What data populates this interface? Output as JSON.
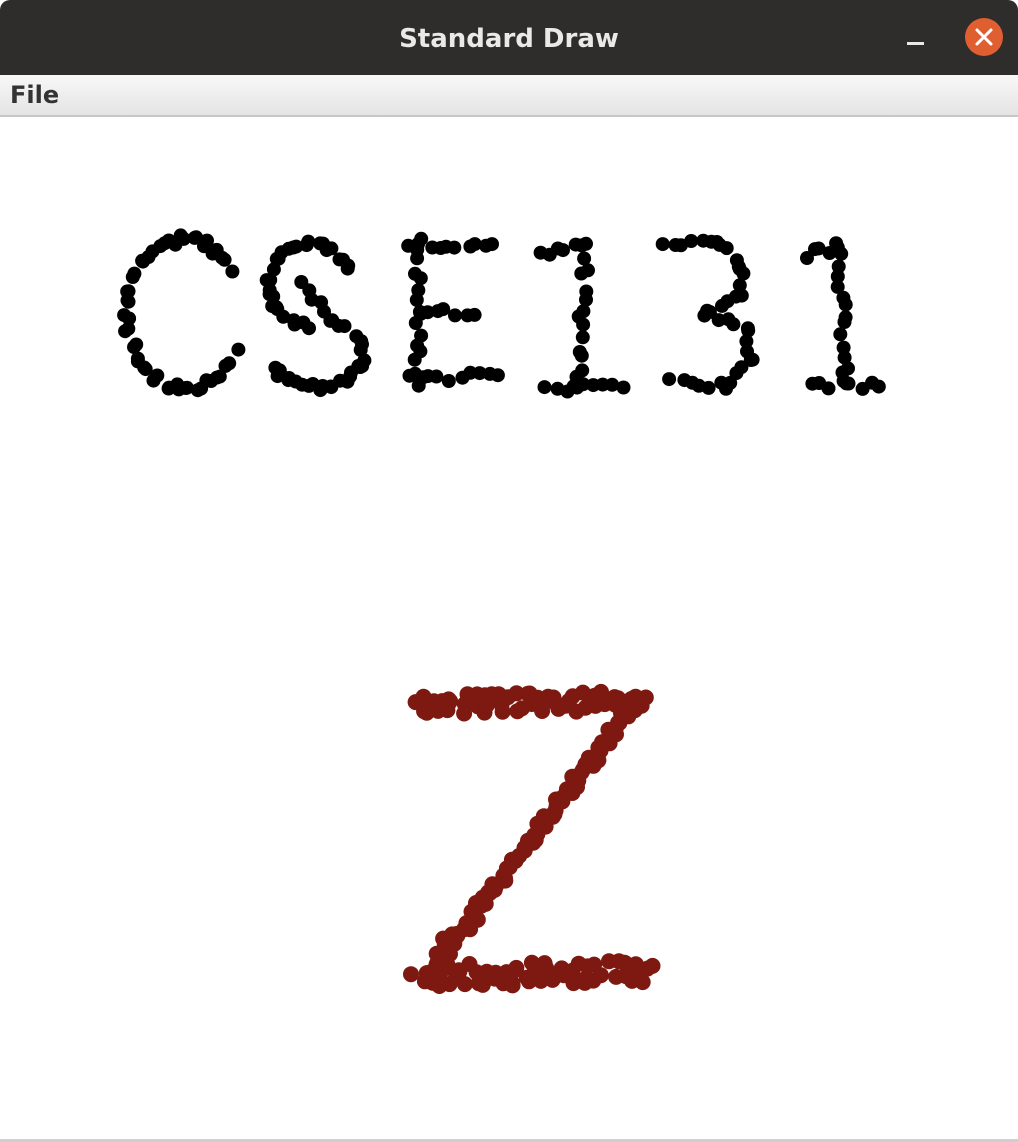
{
  "window": {
    "title": "Standard Draw"
  },
  "titlebar_buttons": {
    "minimize_icon": "minimize-icon",
    "close_icon": "close-icon",
    "close_color": "#e05f30"
  },
  "menubar": {
    "items": [
      {
        "label": "File"
      }
    ]
  },
  "canvas": {
    "background": "#ffffff",
    "drawings": [
      {
        "text": "CSE131",
        "color": "#000000",
        "style": "dotted"
      },
      {
        "text": "Z",
        "color": "#7d1910",
        "style": "dotted"
      }
    ]
  }
}
